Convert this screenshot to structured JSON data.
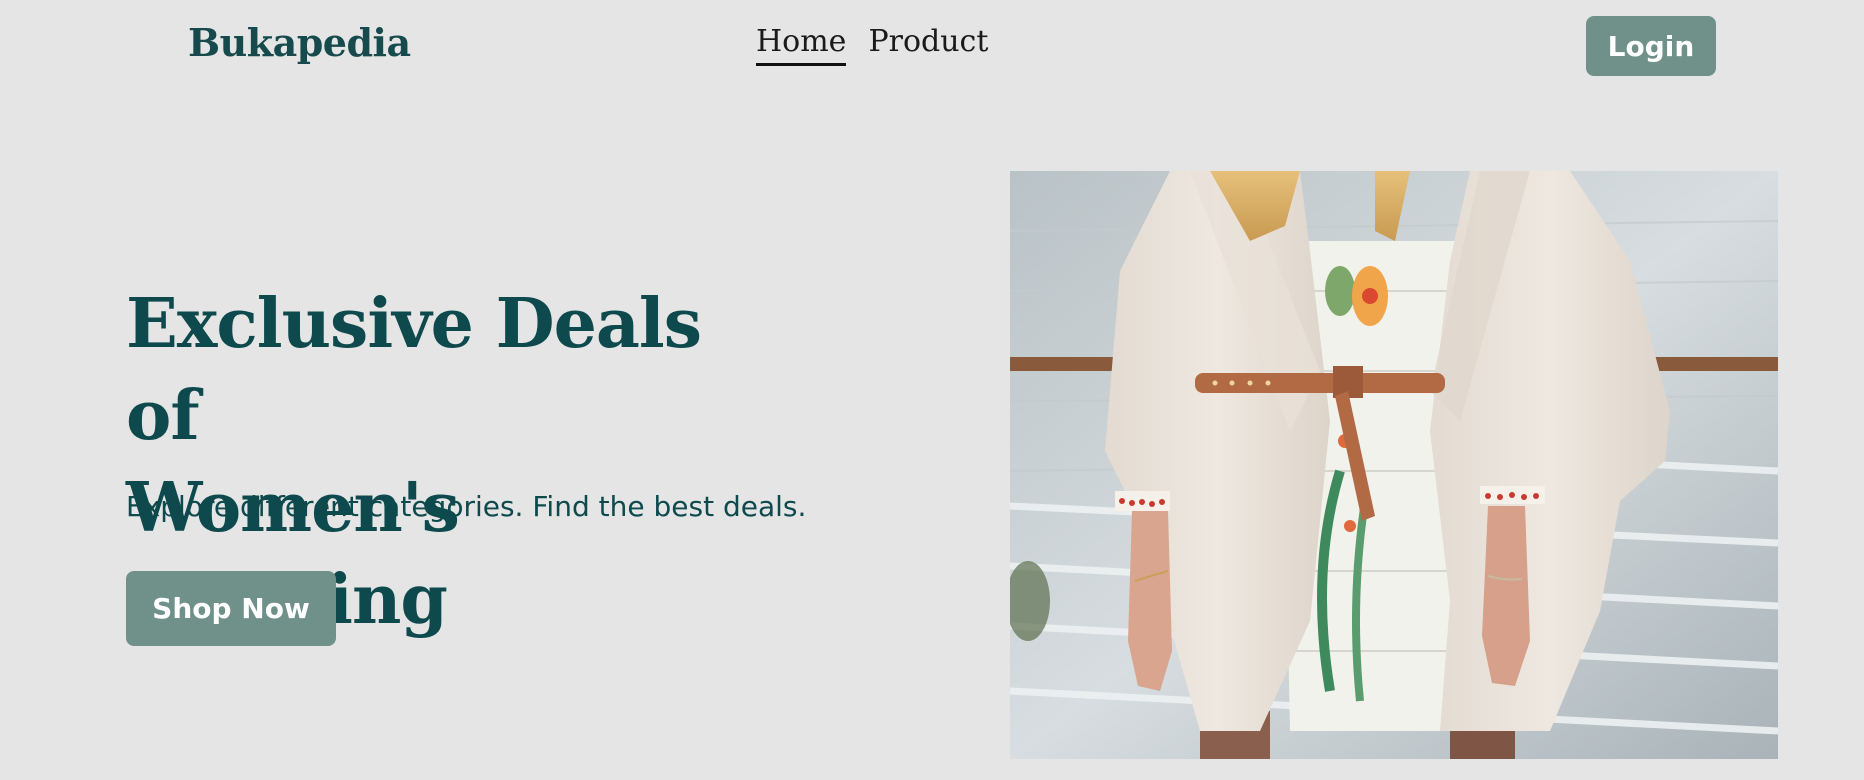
{
  "header": {
    "brand": "Bukapedia",
    "nav": [
      {
        "label": "Home",
        "active": true
      },
      {
        "label": "Product",
        "active": false
      }
    ],
    "login_label": "Login"
  },
  "hero": {
    "title_line1": "Exclusive Deals of",
    "title_line2": "Women's Clothing",
    "subtitle": "Explore different categories. Find the best deals.",
    "cta_label": "Shop Now"
  },
  "colors": {
    "background": "#e5e5e5",
    "brand_text": "#164a4d",
    "button": "#6f918a"
  }
}
